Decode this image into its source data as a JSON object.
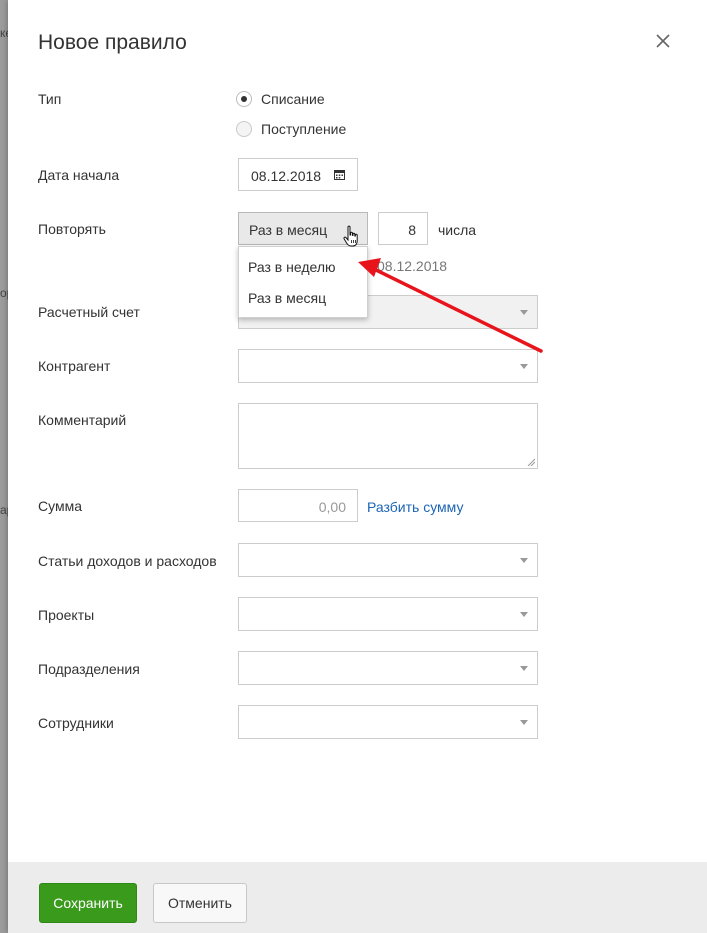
{
  "background": {
    "fragment_1": "ке",
    "fragment_2": "ор",
    "fragment_3": "ар"
  },
  "dialog": {
    "title": "Новое правило",
    "close_icon": "close-icon"
  },
  "form": {
    "type": {
      "label": "Тип",
      "options": [
        {
          "label": "Списание",
          "checked": true
        },
        {
          "label": "Поступление",
          "checked": false
        }
      ]
    },
    "start_date": {
      "label": "Дата начала",
      "value": "08.12.2018",
      "icon": "calendar-icon"
    },
    "repeat": {
      "label": "Повторять",
      "selected": "Раз в месяц",
      "day_value": "8",
      "day_suffix": "числа",
      "start_note": "08.12.2018",
      "dropdown_options": [
        "Раз в неделю",
        "Раз в месяц"
      ]
    },
    "account": {
      "label": "Расчетный счет"
    },
    "counterparty": {
      "label": "Контрагент"
    },
    "comment": {
      "label": "Комментарий"
    },
    "amount": {
      "label": "Сумма",
      "placeholder": "0,00",
      "split_link": "Разбить сумму"
    },
    "categories": {
      "label": "Статьи доходов и расходов"
    },
    "projects": {
      "label": "Проекты"
    },
    "departments": {
      "label": "Подразделения"
    },
    "employees": {
      "label": "Сотрудники"
    }
  },
  "footer": {
    "save_label": "Сохранить",
    "cancel_label": "Отменить"
  },
  "colors": {
    "save_button": "#3a9a1c",
    "link": "#1c64b4",
    "annotation_arrow": "#e8141c",
    "footer_bg": "#ececec"
  }
}
